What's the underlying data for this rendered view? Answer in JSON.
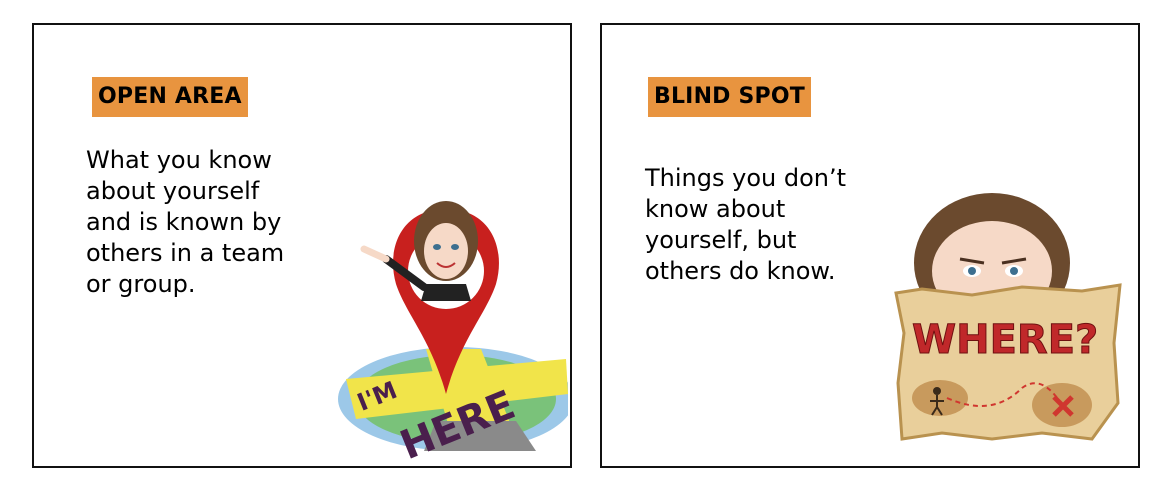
{
  "panels": [
    {
      "heading": "OPEN AREA",
      "body": "What you know\nabout yourself\nand is known by\nothers in a team\nor group."
    },
    {
      "heading": "BLIND SPOT",
      "body": "Things you don’t\nknow about\nyourself, but\nothers do know."
    }
  ],
  "illustrations": {
    "left": {
      "sign_top": "I'M",
      "sign_bottom": "HERE"
    },
    "right": {
      "map_word": "WHERE?"
    }
  },
  "colors": {
    "heading_bg": "#e8943f",
    "pin_red": "#c8201e",
    "hair_brown": "#6b4a2e",
    "map_parchment": "#e9cf9b"
  }
}
